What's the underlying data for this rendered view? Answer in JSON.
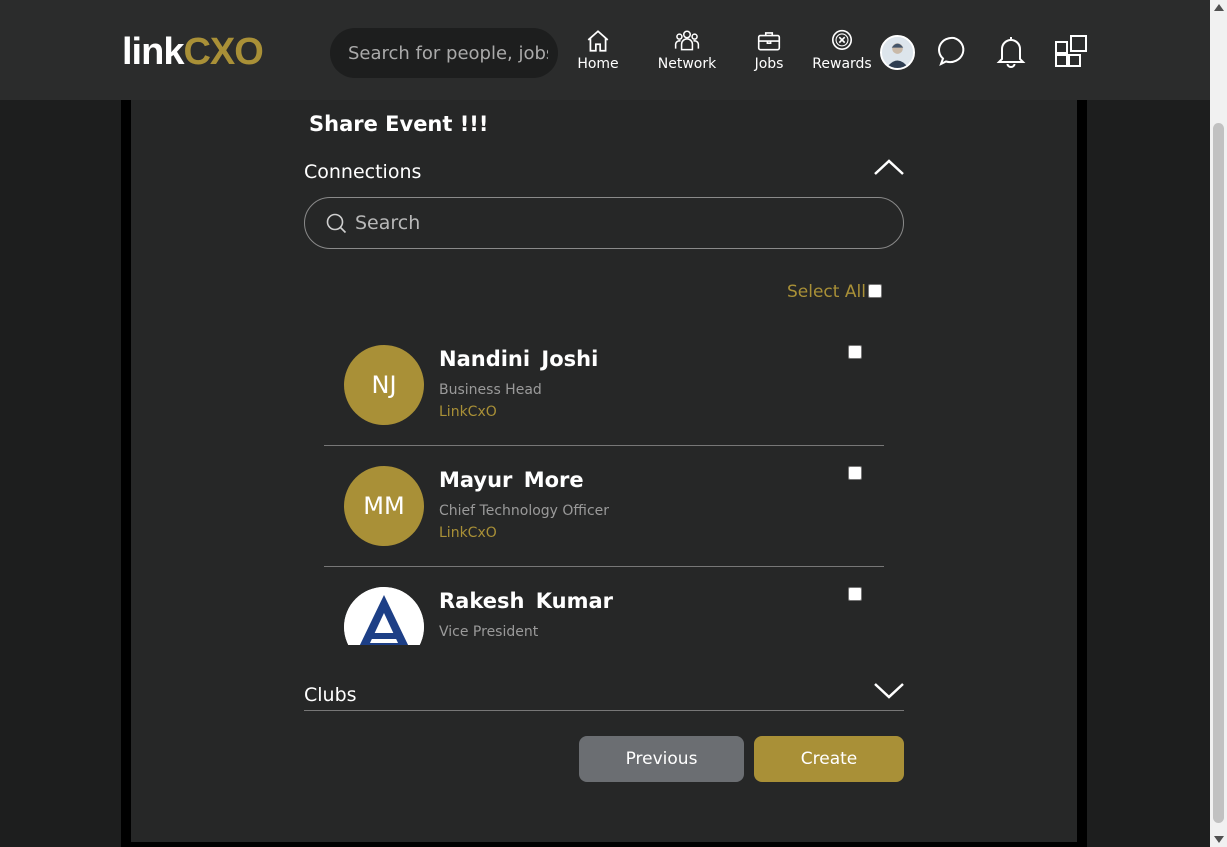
{
  "header": {
    "logo_link": "link",
    "logo_cxo": "CXO",
    "search_placeholder": "Search for people, jobs",
    "nav": [
      {
        "label": "Home",
        "icon": "home-icon"
      },
      {
        "label": "Network",
        "icon": "network-icon"
      },
      {
        "label": "Jobs",
        "icon": "briefcase-icon"
      },
      {
        "label": "Rewards",
        "icon": "rewards-icon"
      }
    ]
  },
  "modal": {
    "title": "Share Event !!!",
    "connections_label": "Connections",
    "search_placeholder": "Search",
    "select_all_label": "Select All",
    "clubs_label": "Clubs",
    "connections": [
      {
        "initials": "NJ",
        "name": "Nandini  Joshi",
        "title": "Business Head",
        "company": "LinkCxO",
        "checked": false
      },
      {
        "initials": "MM",
        "name": "Mayur  More",
        "title": "Chief Technology Officer",
        "company": "LinkCxO",
        "checked": false
      },
      {
        "initials": "",
        "name": "Rakesh  Kumar",
        "title": "Vice President",
        "company": "",
        "checked": false
      }
    ],
    "previous_label": "Previous",
    "create_label": "Create"
  },
  "colors": {
    "accent": "#a99037",
    "background": "#1d1e1e",
    "panel": "#262727",
    "topbar": "#2b2c2c"
  }
}
